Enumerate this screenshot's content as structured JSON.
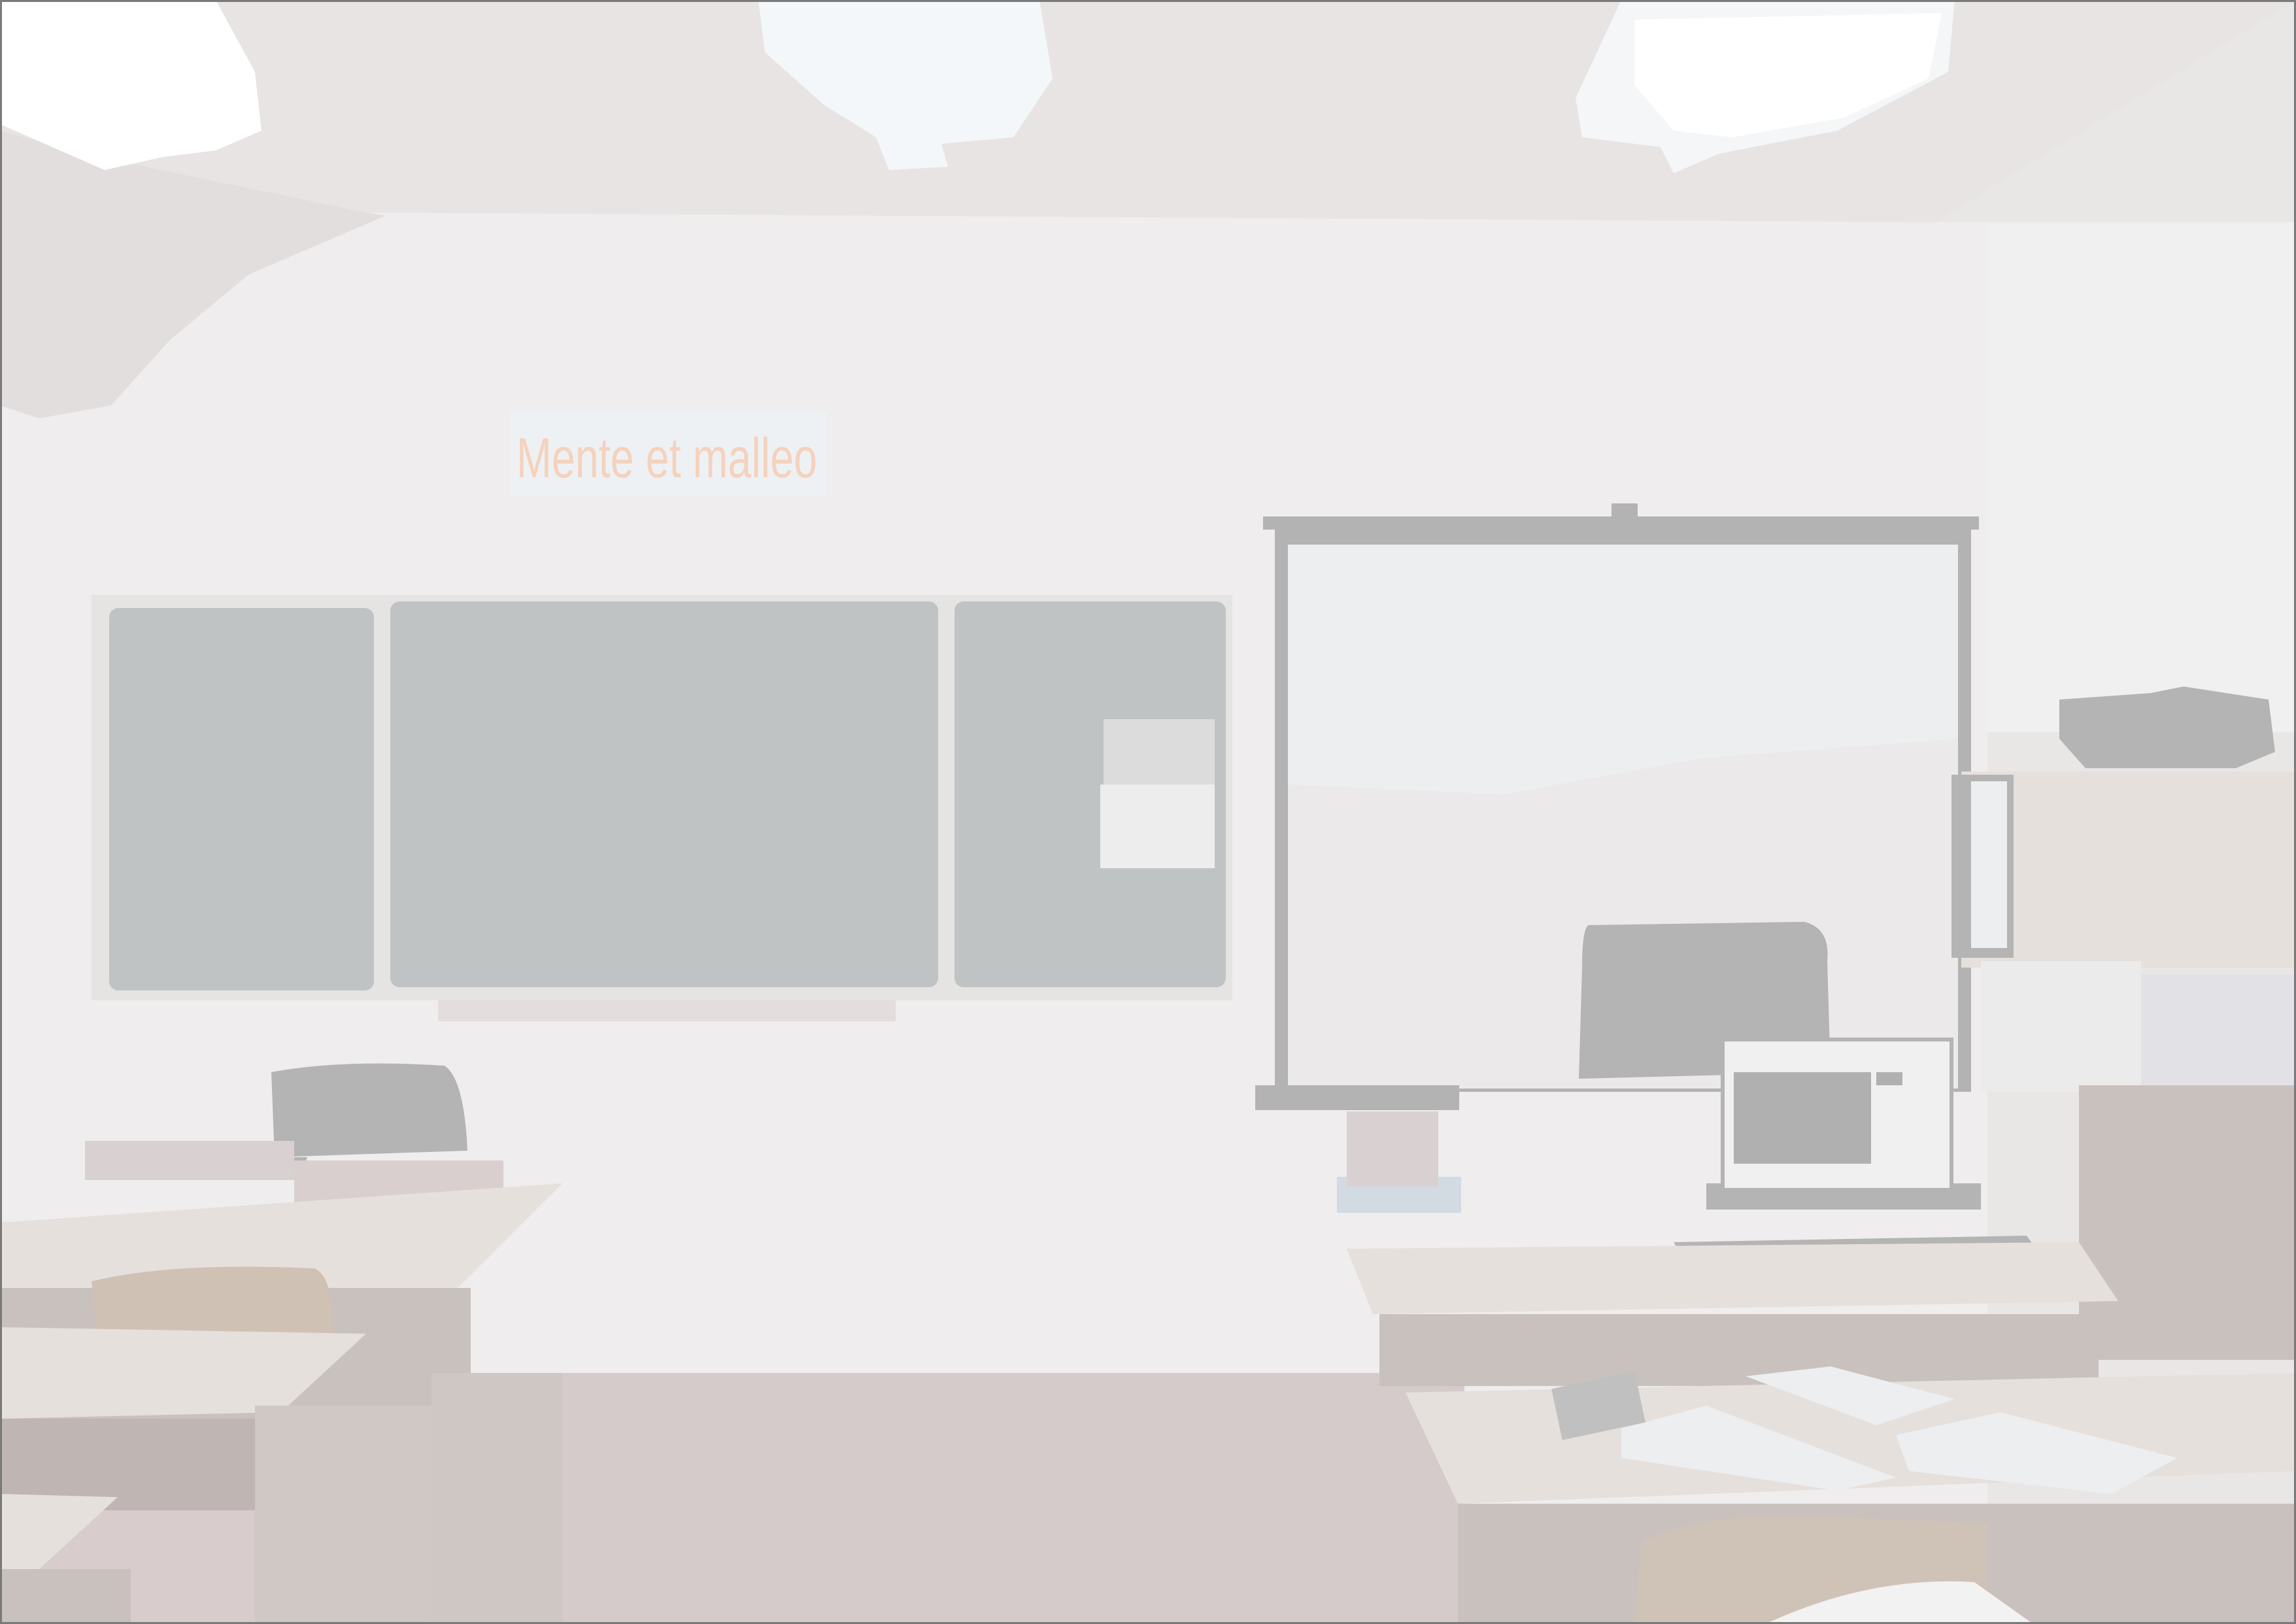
{
  "wall_sign": {
    "text": "Mente et malleo"
  },
  "colors": {
    "ceiling": "#e8e4e4",
    "wall": "#efeded",
    "floor": "#d8cccc",
    "chalkboard": "#bfc3c4",
    "screen": "#eceef0",
    "screen_frame": "#b3b3b3",
    "desk_top": "#e6e0dc",
    "chair": "#b4b4b4",
    "sign_text": "#f5d2bd",
    "sign_panel": "#eef1f4"
  }
}
